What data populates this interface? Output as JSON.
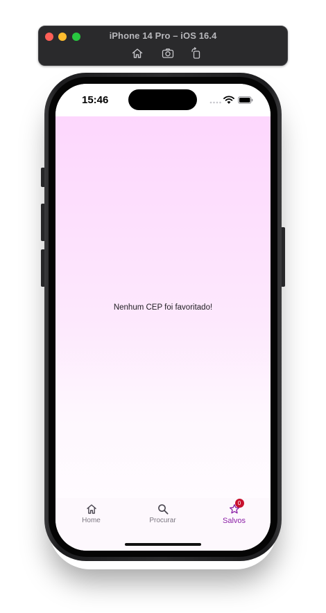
{
  "simulator": {
    "title": "iPhone 14 Pro – iOS 16.4",
    "toolbar": {
      "home_icon": "house-icon",
      "screenshot_icon": "camera-icon",
      "rotate_icon": "rotate-icon"
    }
  },
  "status_bar": {
    "time": "15:46"
  },
  "content": {
    "empty_message": "Nenhum CEP foi favoritado!"
  },
  "bottom_nav": {
    "items": [
      {
        "label": "Home",
        "icon": "home-icon"
      },
      {
        "label": "Procurar",
        "icon": "search-icon"
      },
      {
        "label": "Salvos",
        "icon": "star-icon",
        "badge": "0",
        "selected": true
      }
    ]
  },
  "colors": {
    "accent": "#8b1fa6",
    "badge": "#c8102e",
    "background_top": "#fdd7fd",
    "background_bottom": "#fffbff"
  }
}
